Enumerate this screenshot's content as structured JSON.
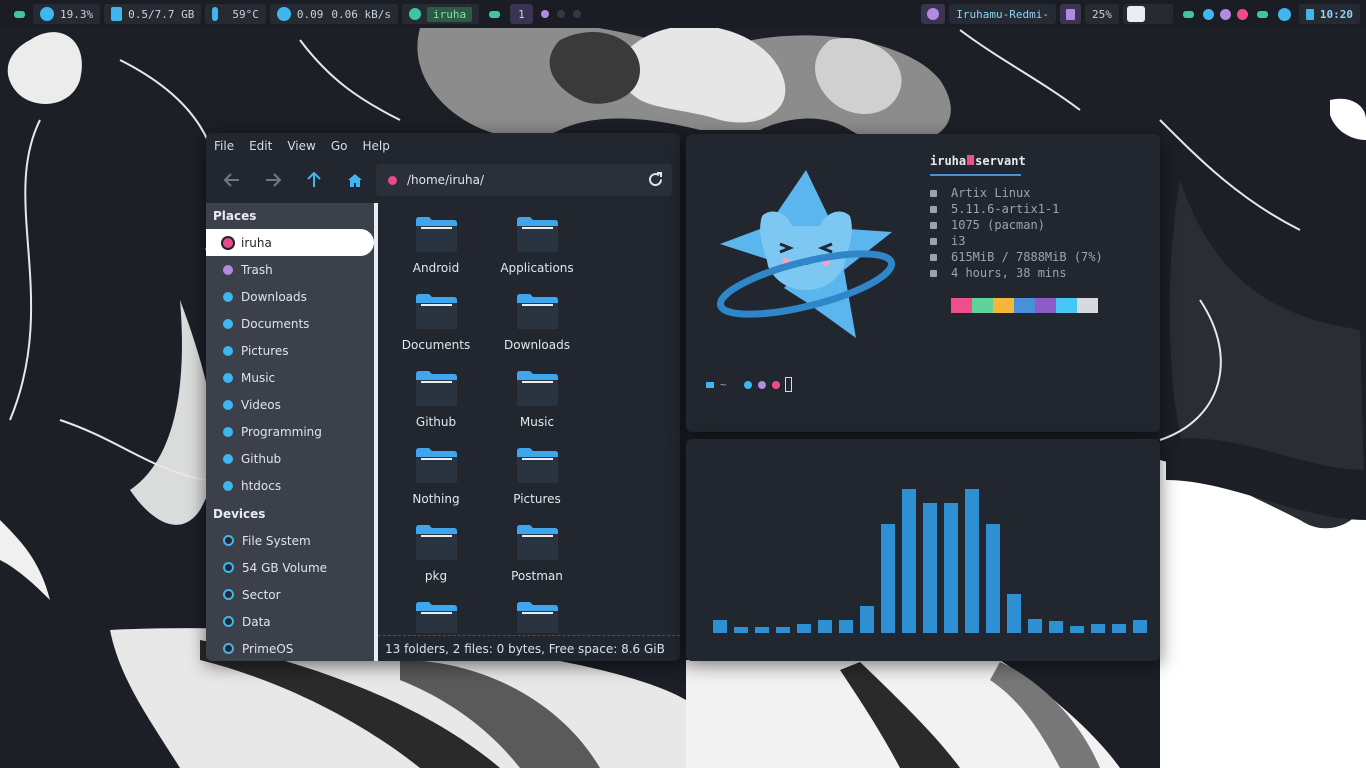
{
  "topbar": {
    "cpu": "19.3%",
    "memory": "0.5/7.7 GB",
    "temperature": "59°C",
    "net_down": "0.09",
    "net_up": "0.06 kB/s",
    "user": "iruha",
    "workspace": "1",
    "wifi_name": "Iruhamu-Redmi-",
    "volume": "25%",
    "clock": "10:20",
    "colors": {
      "accent": "#3fc6a1",
      "blue": "#3fb6f0",
      "purple": "#b08be0",
      "pink": "#f04a8c"
    },
    "icons": [
      "chip-icon",
      "sd-card-icon",
      "thermometer-icon",
      "network-icon",
      "user-icon",
      "wifi-icon",
      "volume-icon",
      "phone-icon",
      "power-icon",
      "bookmark-icon"
    ]
  },
  "file_manager": {
    "menu": [
      "File",
      "Edit",
      "View",
      "Go",
      "Help"
    ],
    "path": "/home/iruha/",
    "places_title": "Places",
    "places": [
      {
        "label": "iruha",
        "color": "#ea4a8c",
        "active": true
      },
      {
        "label": "Trash",
        "color": "#b08be0"
      },
      {
        "label": "Downloads",
        "color": "#3fb6f0"
      },
      {
        "label": "Documents",
        "color": "#3fb6f0"
      },
      {
        "label": "Pictures",
        "color": "#3fb6f0"
      },
      {
        "label": "Music",
        "color": "#3fb6f0"
      },
      {
        "label": "Videos",
        "color": "#3fb6f0"
      },
      {
        "label": "Programming",
        "color": "#3fb6f0"
      },
      {
        "label": "Github",
        "color": "#3fb6f0"
      },
      {
        "label": "htdocs",
        "color": "#3fb6f0"
      }
    ],
    "devices_title": "Devices",
    "devices": [
      "File System",
      "54 GB Volume",
      "Sector",
      "Data",
      "PrimeOS"
    ],
    "folders": [
      "Android",
      "Applications",
      "Documents",
      "Downloads",
      "Github",
      "Music",
      "Nothing",
      "Pictures",
      "pkg",
      "Postman",
      "",
      ""
    ],
    "status": "13 folders, 2 files: 0 bytes, Free space: 8.6 GiB"
  },
  "terminal": {
    "user": "iruha",
    "host": "servant",
    "info": [
      {
        "icon": "heart-icon",
        "text": "Artix Linux"
      },
      {
        "icon": "gear-icon",
        "text": "5.11.6-artix1-1"
      },
      {
        "icon": "package-icon",
        "text": "1075 (pacman)"
      },
      {
        "icon": "window-icon",
        "text": "i3"
      },
      {
        "icon": "leaf-icon",
        "text": "615MiB / 7888MiB (7%)"
      },
      {
        "icon": "bulb-icon",
        "text": "4 hours, 38 mins"
      }
    ],
    "palette": [
      "#22262e",
      "#ee4f8a",
      "#5ed39b",
      "#f4b73a",
      "#4a90d9",
      "#8b5cc8",
      "#48c6f4",
      "#d6d9de"
    ],
    "prompt_dir": "~"
  },
  "visualizer": {
    "levels": [
      0.09,
      0.04,
      0.04,
      0.04,
      0.06,
      0.09,
      0.09,
      0.19,
      0.76,
      1.0,
      0.9,
      0.9,
      1.0,
      0.76,
      0.27,
      0.1,
      0.08,
      0.05,
      0.06,
      0.06,
      0.09
    ],
    "color": "#2e8fd2"
  }
}
